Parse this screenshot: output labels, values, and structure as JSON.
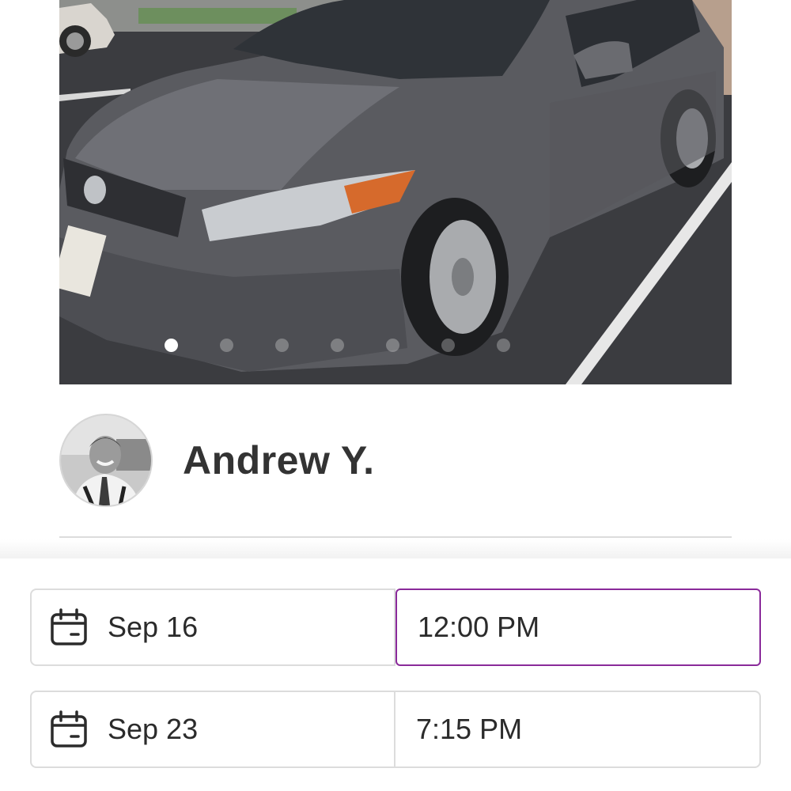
{
  "listing": {
    "photo_count": 7,
    "active_photo_index": 0,
    "host_name": "Andrew Y."
  },
  "trip": {
    "start": {
      "date": "Sep 16",
      "time": "12:00 PM"
    },
    "end": {
      "date": "Sep 23",
      "time": "7:15 PM"
    }
  },
  "colors": {
    "selected_border": "#8a2a9a",
    "field_border": "#dcdcdc",
    "text": "#2b2b2b"
  },
  "icons": {
    "calendar": "calendar-icon"
  }
}
